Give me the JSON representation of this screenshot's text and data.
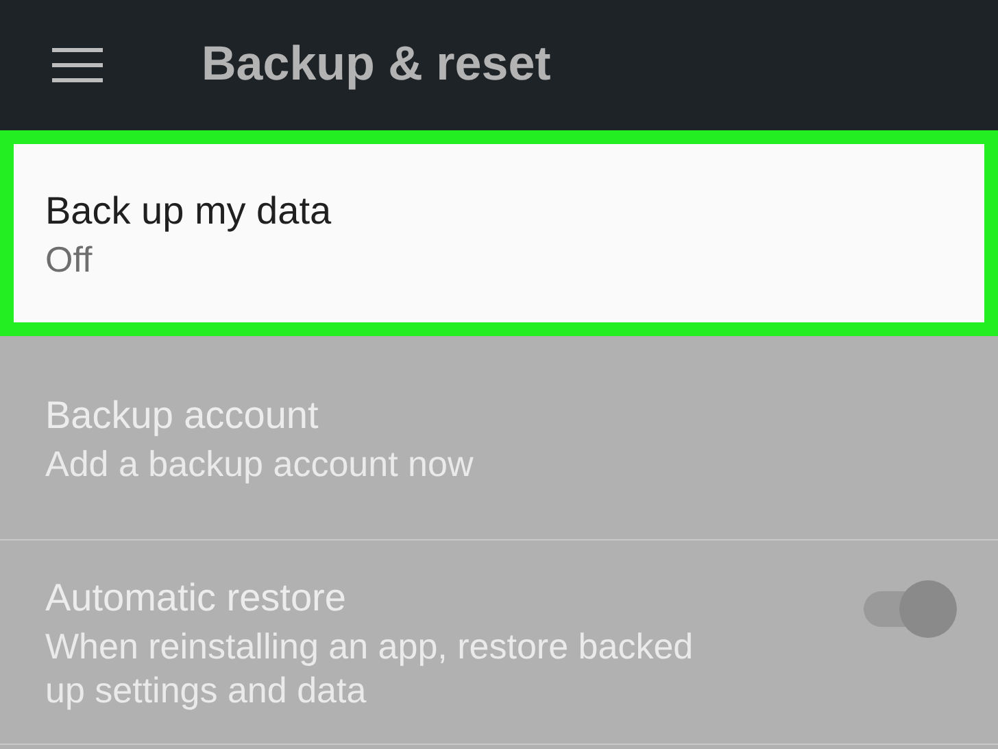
{
  "app_bar": {
    "title": "Backup & reset"
  },
  "settings": [
    {
      "kind": "text",
      "title": "Back up my data",
      "summary": "Off",
      "disabled": false,
      "highlighted": true
    },
    {
      "kind": "text",
      "title": "Backup account",
      "summary": "Add a backup account now",
      "disabled": true,
      "highlighted": false
    },
    {
      "kind": "toggle",
      "title": "Automatic restore",
      "summary": "When reinstalling an app, restore backed up settings and data",
      "disabled": true,
      "highlighted": false,
      "on": true
    }
  ]
}
